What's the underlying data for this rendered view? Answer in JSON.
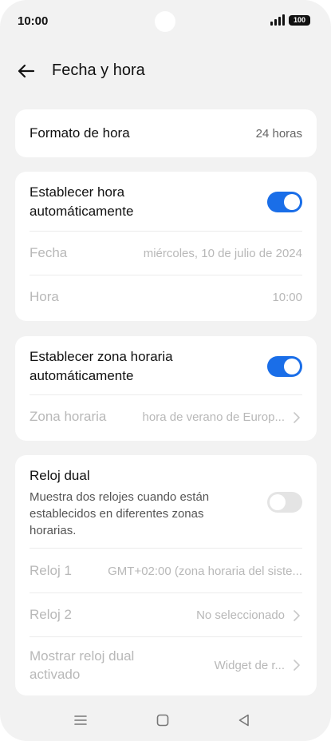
{
  "status_bar": {
    "time": "10:00",
    "battery": "100"
  },
  "header": {
    "title": "Fecha y hora",
    "back_icon": "arrow-left-icon"
  },
  "time_format": {
    "label": "Formato de hora",
    "value": "24 horas"
  },
  "auto_time": {
    "label_line1": "Establecer hora",
    "label_line2": "automáticamente",
    "toggle_on": true,
    "date_label": "Fecha",
    "date_value": "miércoles, 10 de julio de 2024",
    "hour_label": "Hora",
    "hour_value": "10:00"
  },
  "auto_zone": {
    "label_line1": "Establecer zona horaria",
    "label_line2": "automáticamente",
    "toggle_on": true,
    "zone_label": "Zona horaria",
    "zone_value": "hora de verano de Europ..."
  },
  "dual_clock": {
    "label": "Reloj dual",
    "desc_line1": "Muestra dos relojes cuando están",
    "desc_line2": "establecidos en diferentes zonas",
    "desc_line3": "horarias.",
    "toggle_on": false,
    "clock1_label": "Reloj 1",
    "clock1_value": "GMT+02:00 (zona horaria del siste...",
    "clock2_label": "Reloj 2",
    "clock2_value": "No seleccionado",
    "show_label_line1": "Mostrar reloj dual",
    "show_label_line2": "activado",
    "show_value": "Widget de r..."
  },
  "nav_bar": {
    "icons": [
      "menu-icon",
      "home-icon",
      "back-triangle-icon"
    ]
  },
  "colors": {
    "accent": "#1a6ee8",
    "background": "#f2f2f2",
    "card": "#ffffff"
  }
}
